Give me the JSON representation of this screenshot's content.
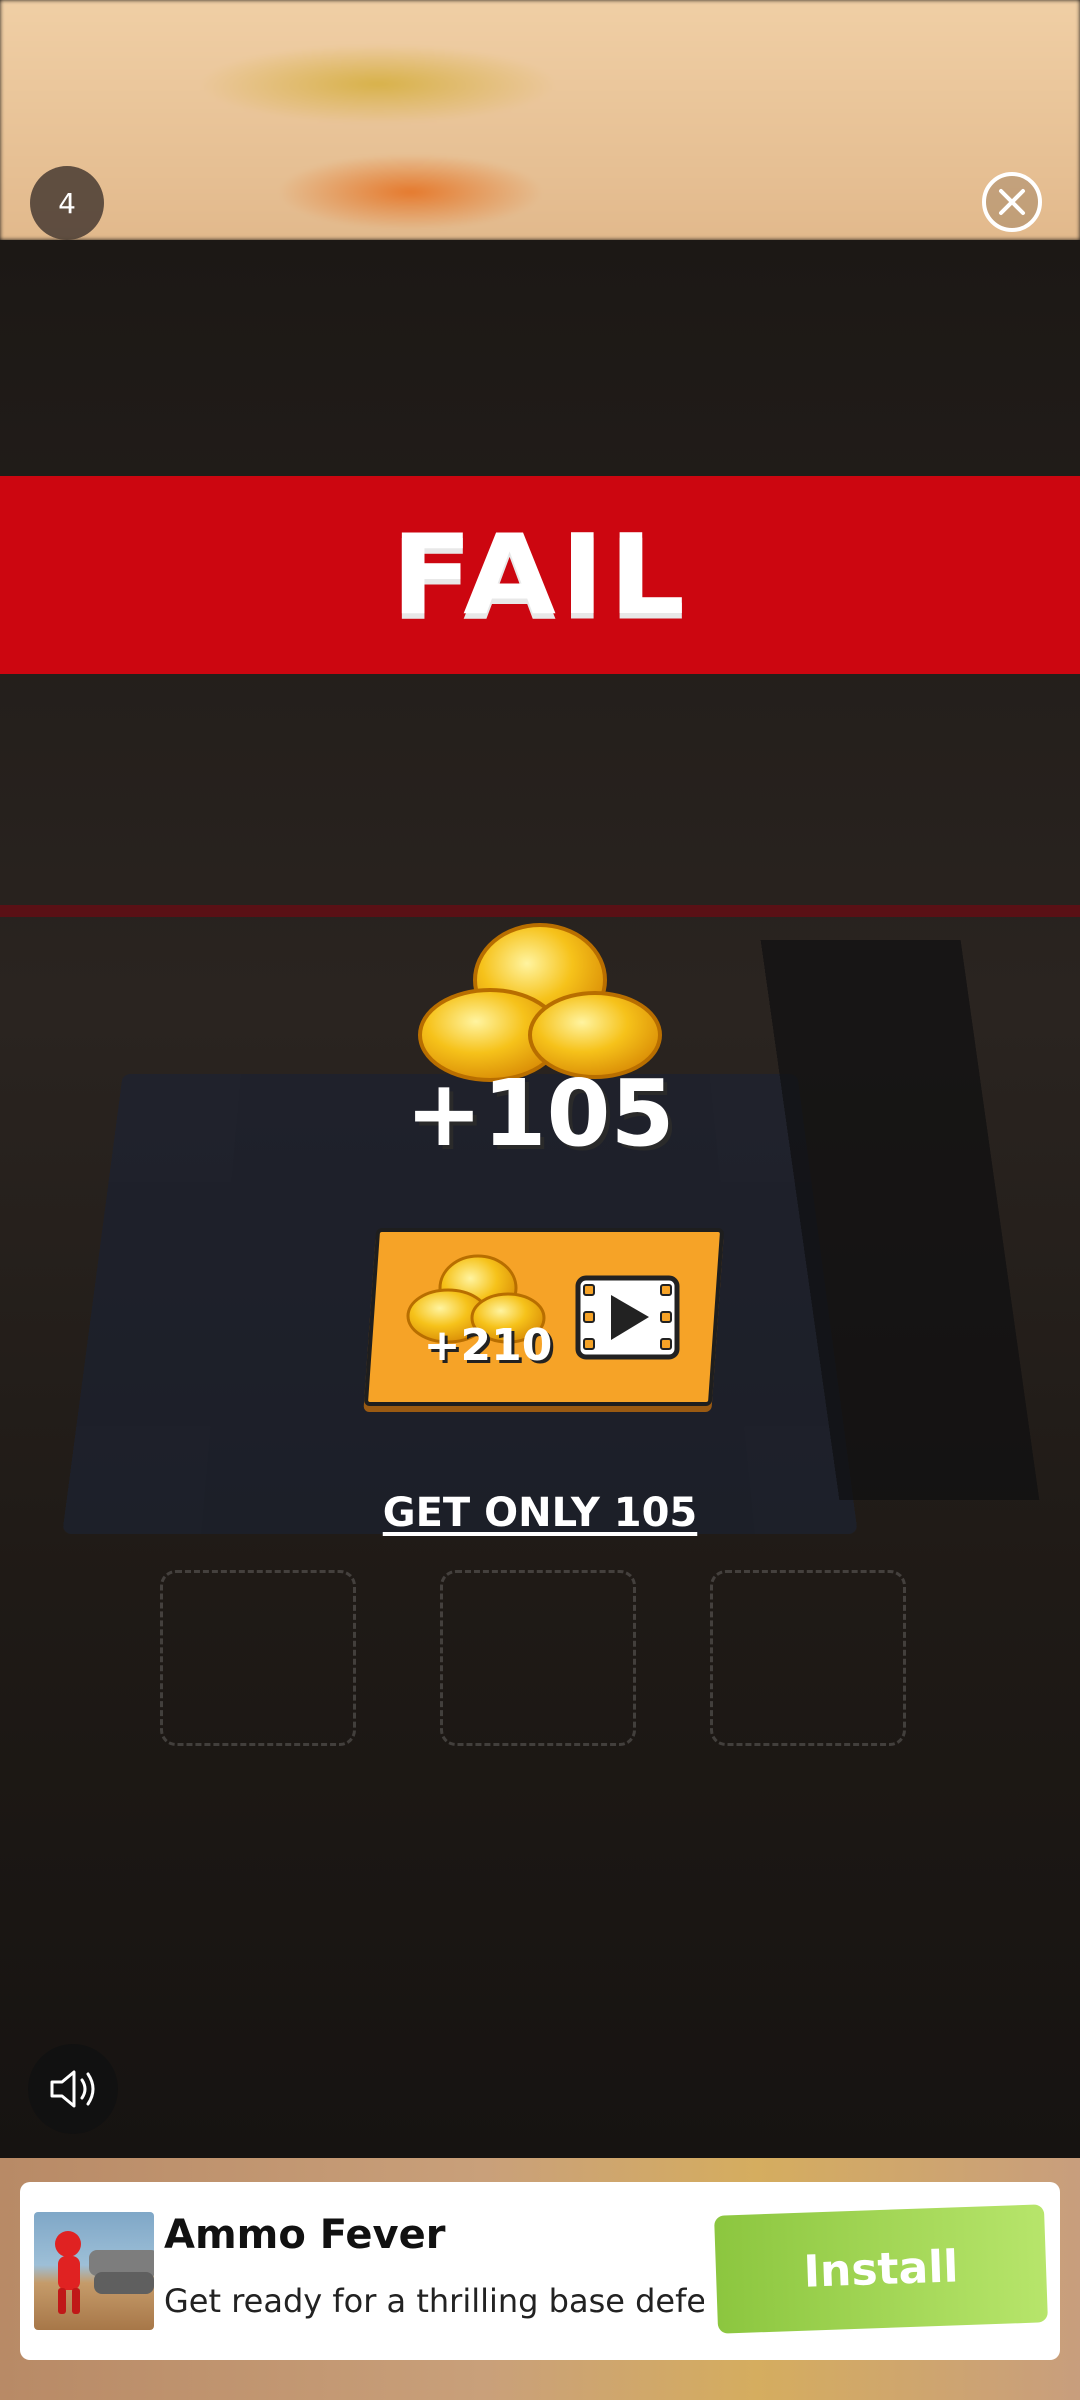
{
  "top_bar": {
    "level_number": "4"
  },
  "result": {
    "banner_text": "FAIL",
    "coin_reward": "+105",
    "ad_reward": "+210",
    "skip_text": "GET ONLY 105"
  },
  "icons": {
    "close": "close-circle-icon",
    "sound": "speaker-icon",
    "video": "video-play-icon",
    "coins": "coins-pile-icon"
  },
  "ad": {
    "title": "Ammo Fever",
    "description": "Get ready for a thrilling base defen…",
    "install_label": "Install"
  },
  "colors": {
    "banner_red": "#cc0610",
    "button_orange": "#f6a327",
    "install_green": "#8cc63f"
  }
}
